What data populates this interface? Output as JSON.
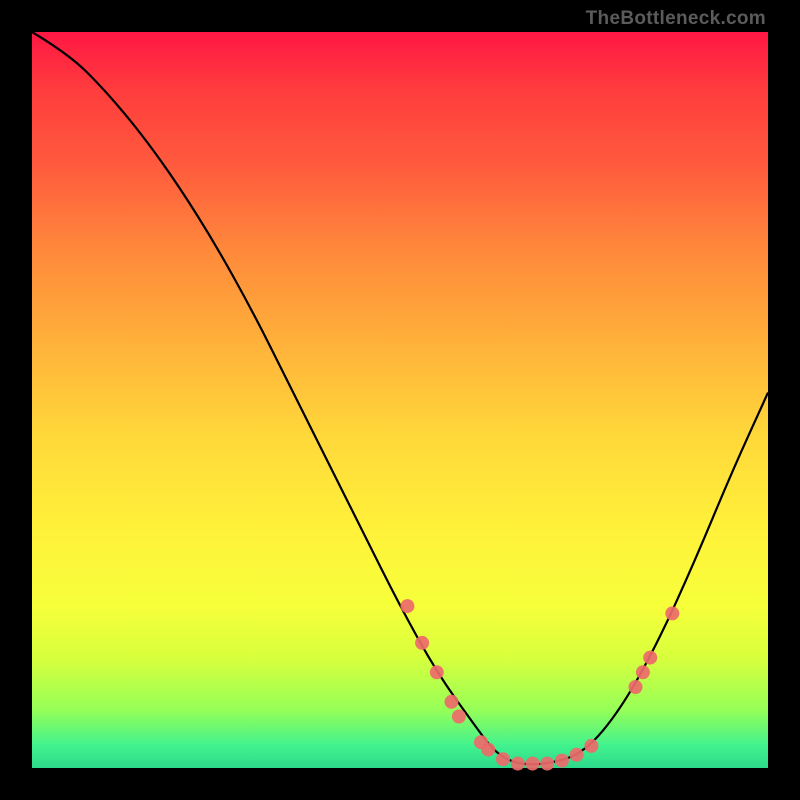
{
  "watermark": "TheBottleneck.com",
  "chart_data": {
    "type": "line",
    "title": "",
    "xlabel": "",
    "ylabel": "",
    "xlim": [
      0,
      100
    ],
    "ylim": [
      0,
      100
    ],
    "curve": {
      "x": [
        0,
        5,
        10,
        15,
        20,
        25,
        30,
        35,
        40,
        45,
        50,
        55,
        60,
        63,
        66,
        70,
        75,
        80,
        85,
        90,
        95,
        100
      ],
      "y": [
        100,
        97,
        92,
        86,
        79,
        71,
        62,
        52,
        42,
        32,
        22,
        13,
        6,
        2,
        0.5,
        0.5,
        2,
        8,
        17,
        28,
        40,
        51
      ]
    },
    "points": [
      {
        "x": 51,
        "y": 22
      },
      {
        "x": 53,
        "y": 17
      },
      {
        "x": 55,
        "y": 13
      },
      {
        "x": 57,
        "y": 9
      },
      {
        "x": 58,
        "y": 7
      },
      {
        "x": 61,
        "y": 3.5
      },
      {
        "x": 62,
        "y": 2.5
      },
      {
        "x": 64,
        "y": 1.2
      },
      {
        "x": 66,
        "y": 0.6
      },
      {
        "x": 68,
        "y": 0.6
      },
      {
        "x": 70,
        "y": 0.6
      },
      {
        "x": 72,
        "y": 1.0
      },
      {
        "x": 74,
        "y": 1.8
      },
      {
        "x": 76,
        "y": 3.0
      },
      {
        "x": 82,
        "y": 11
      },
      {
        "x": 83,
        "y": 13
      },
      {
        "x": 84,
        "y": 15
      },
      {
        "x": 87,
        "y": 21
      }
    ],
    "point_color": "#ed6a6a",
    "curve_color": "#000000"
  }
}
